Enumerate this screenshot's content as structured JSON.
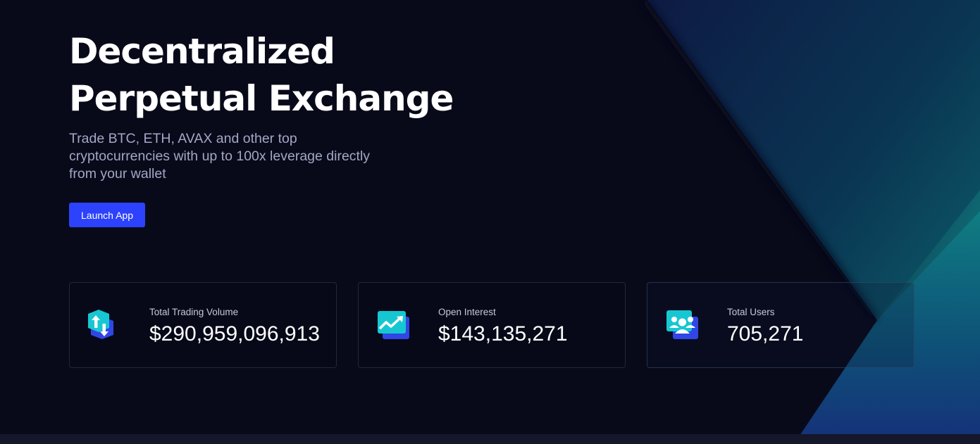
{
  "hero": {
    "title": "Decentralized\nPerpetual Exchange",
    "subtitle": "Trade BTC, ETH, AVAX and other top cryptocurrencies with up to 100x leverage directly from your wallet",
    "cta_label": "Launch App"
  },
  "stats": [
    {
      "label": "Total Trading Volume",
      "value": "$290,959,096,913",
      "icon": "trade-arrows-icon"
    },
    {
      "label": "Open Interest",
      "value": "$143,135,271",
      "icon": "chart-trend-icon"
    },
    {
      "label": "Total Users",
      "value": "705,271",
      "icon": "users-icon"
    }
  ],
  "colors": {
    "background": "#080a1a",
    "accent": "#2d42fc",
    "teal": "#12c4c4",
    "subtitle": "#a3a7c5"
  }
}
